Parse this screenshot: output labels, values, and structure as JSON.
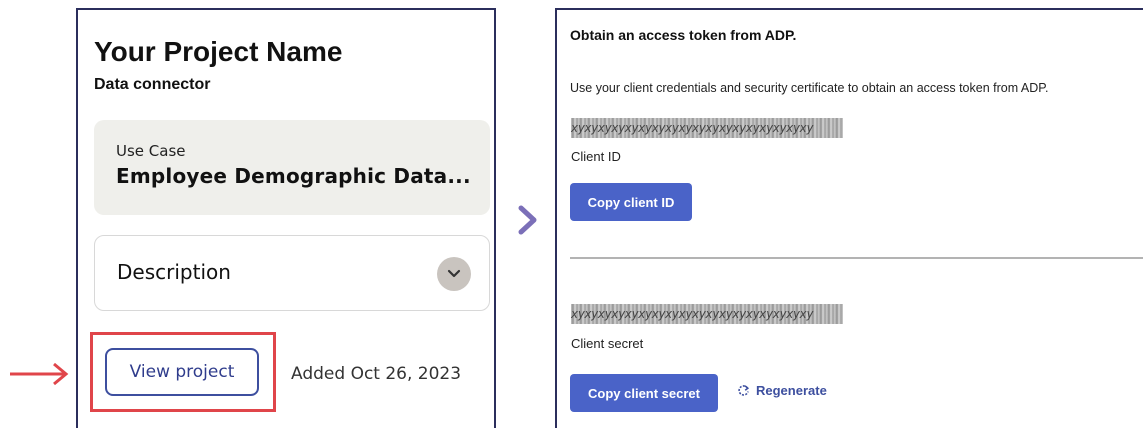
{
  "project_card": {
    "title": "Your Project Name",
    "subtitle": "Data connector",
    "use_case": {
      "label": "Use Case",
      "value": "Employee Demographic Data..."
    },
    "description": {
      "label": "Description",
      "toggle_icon": "chevron-down-icon"
    },
    "view_button_label": "View project",
    "added_text": "Added Oct 26, 2023"
  },
  "token_panel": {
    "title": "Obtain an access token from ADP.",
    "description": "Use your client credentials and security certificate to obtain an access token from ADP.",
    "client_id": {
      "masked_value": "xyxyxyxyxyxyxyxyxyxyxyxyxyxyxyxyxyxy",
      "label": "Client ID",
      "copy_button_label": "Copy client ID"
    },
    "client_secret": {
      "masked_value": "xyxyxyxyxyxyxyxyxyxyxyxyxyxyxyxyxyxy",
      "label": "Client secret",
      "copy_button_label": "Copy client secret"
    },
    "regenerate_label": "Regenerate"
  },
  "colors": {
    "card_border": "#2b2e5c",
    "primary_button": "#4a63c8",
    "highlight": "#e0454a",
    "chevron_accent": "#7b6fb8"
  }
}
